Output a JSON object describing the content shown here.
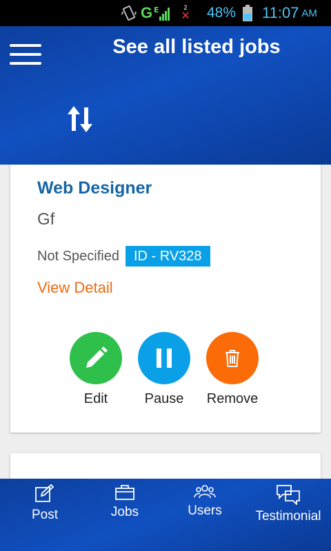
{
  "status_bar": {
    "network": "G",
    "battery_percent": "48%",
    "time": "11:07",
    "ampm": "AM",
    "sim_label": "2"
  },
  "header": {
    "title": "See all listed jobs"
  },
  "job_card": {
    "title": "Web Designer",
    "company": "Gf",
    "job_type": "Not Specified",
    "job_id": "ID - RV328",
    "view_detail": "View Detail",
    "actions": {
      "edit": "Edit",
      "pause": "Pause",
      "remove": "Remove"
    }
  },
  "bottom_nav": {
    "items": [
      {
        "label": "Post",
        "icon": "edit-square-icon"
      },
      {
        "label": "Jobs",
        "icon": "briefcase-icon"
      },
      {
        "label": "Users",
        "icon": "users-icon"
      },
      {
        "label": "Testimonial",
        "icon": "chat-bubbles-icon"
      }
    ]
  },
  "colors": {
    "header_blue": "#1150c0",
    "title_blue": "#1565a5",
    "id_badge": "#0aa0e8",
    "view_detail_orange": "#f06a12",
    "edit_green": "#2ec04a",
    "pause_blue": "#0aa0e8",
    "remove_orange": "#fb6b08"
  }
}
